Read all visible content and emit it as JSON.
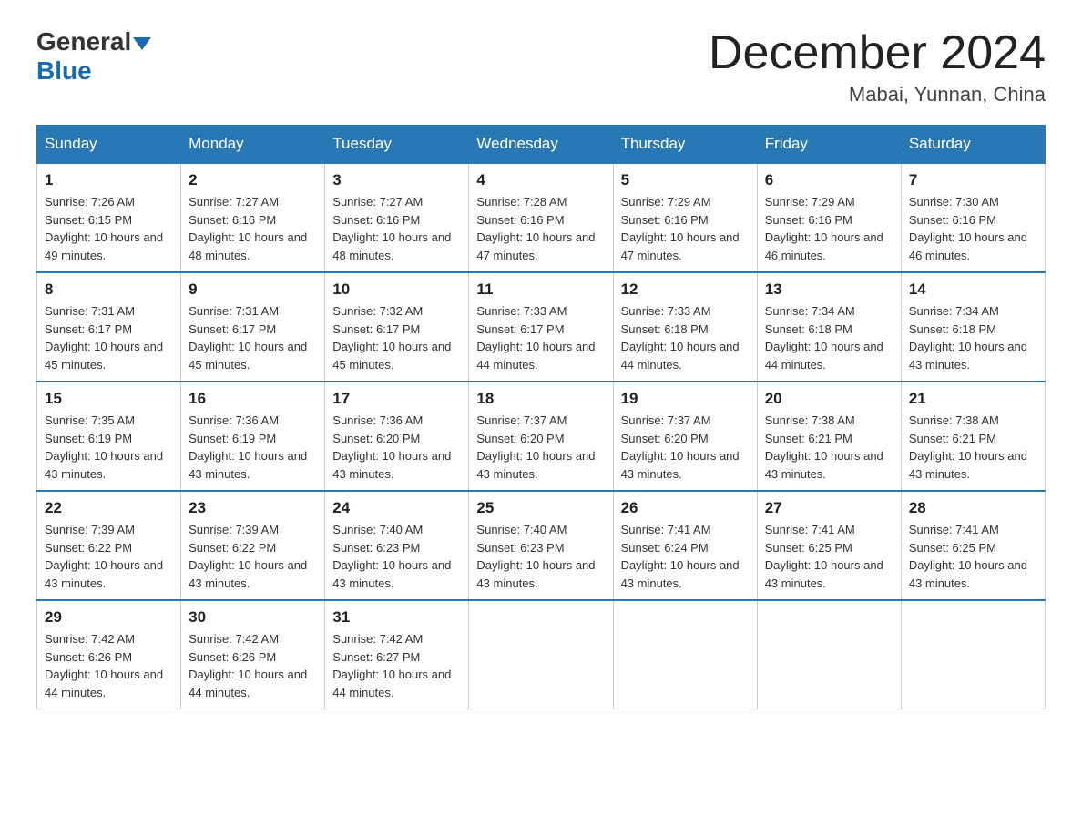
{
  "header": {
    "logo_general": "General",
    "logo_blue": "Blue",
    "month_title": "December 2024",
    "location": "Mabai, Yunnan, China"
  },
  "days_of_week": [
    "Sunday",
    "Monday",
    "Tuesday",
    "Wednesday",
    "Thursday",
    "Friday",
    "Saturday"
  ],
  "weeks": [
    [
      {
        "day": "1",
        "sunrise": "7:26 AM",
        "sunset": "6:15 PM",
        "daylight": "10 hours and 49 minutes."
      },
      {
        "day": "2",
        "sunrise": "7:27 AM",
        "sunset": "6:16 PM",
        "daylight": "10 hours and 48 minutes."
      },
      {
        "day": "3",
        "sunrise": "7:27 AM",
        "sunset": "6:16 PM",
        "daylight": "10 hours and 48 minutes."
      },
      {
        "day": "4",
        "sunrise": "7:28 AM",
        "sunset": "6:16 PM",
        "daylight": "10 hours and 47 minutes."
      },
      {
        "day": "5",
        "sunrise": "7:29 AM",
        "sunset": "6:16 PM",
        "daylight": "10 hours and 47 minutes."
      },
      {
        "day": "6",
        "sunrise": "7:29 AM",
        "sunset": "6:16 PM",
        "daylight": "10 hours and 46 minutes."
      },
      {
        "day": "7",
        "sunrise": "7:30 AM",
        "sunset": "6:16 PM",
        "daylight": "10 hours and 46 minutes."
      }
    ],
    [
      {
        "day": "8",
        "sunrise": "7:31 AM",
        "sunset": "6:17 PM",
        "daylight": "10 hours and 45 minutes."
      },
      {
        "day": "9",
        "sunrise": "7:31 AM",
        "sunset": "6:17 PM",
        "daylight": "10 hours and 45 minutes."
      },
      {
        "day": "10",
        "sunrise": "7:32 AM",
        "sunset": "6:17 PM",
        "daylight": "10 hours and 45 minutes."
      },
      {
        "day": "11",
        "sunrise": "7:33 AM",
        "sunset": "6:17 PM",
        "daylight": "10 hours and 44 minutes."
      },
      {
        "day": "12",
        "sunrise": "7:33 AM",
        "sunset": "6:18 PM",
        "daylight": "10 hours and 44 minutes."
      },
      {
        "day": "13",
        "sunrise": "7:34 AM",
        "sunset": "6:18 PM",
        "daylight": "10 hours and 44 minutes."
      },
      {
        "day": "14",
        "sunrise": "7:34 AM",
        "sunset": "6:18 PM",
        "daylight": "10 hours and 43 minutes."
      }
    ],
    [
      {
        "day": "15",
        "sunrise": "7:35 AM",
        "sunset": "6:19 PM",
        "daylight": "10 hours and 43 minutes."
      },
      {
        "day": "16",
        "sunrise": "7:36 AM",
        "sunset": "6:19 PM",
        "daylight": "10 hours and 43 minutes."
      },
      {
        "day": "17",
        "sunrise": "7:36 AM",
        "sunset": "6:20 PM",
        "daylight": "10 hours and 43 minutes."
      },
      {
        "day": "18",
        "sunrise": "7:37 AM",
        "sunset": "6:20 PM",
        "daylight": "10 hours and 43 minutes."
      },
      {
        "day": "19",
        "sunrise": "7:37 AM",
        "sunset": "6:20 PM",
        "daylight": "10 hours and 43 minutes."
      },
      {
        "day": "20",
        "sunrise": "7:38 AM",
        "sunset": "6:21 PM",
        "daylight": "10 hours and 43 minutes."
      },
      {
        "day": "21",
        "sunrise": "7:38 AM",
        "sunset": "6:21 PM",
        "daylight": "10 hours and 43 minutes."
      }
    ],
    [
      {
        "day": "22",
        "sunrise": "7:39 AM",
        "sunset": "6:22 PM",
        "daylight": "10 hours and 43 minutes."
      },
      {
        "day": "23",
        "sunrise": "7:39 AM",
        "sunset": "6:22 PM",
        "daylight": "10 hours and 43 minutes."
      },
      {
        "day": "24",
        "sunrise": "7:40 AM",
        "sunset": "6:23 PM",
        "daylight": "10 hours and 43 minutes."
      },
      {
        "day": "25",
        "sunrise": "7:40 AM",
        "sunset": "6:23 PM",
        "daylight": "10 hours and 43 minutes."
      },
      {
        "day": "26",
        "sunrise": "7:41 AM",
        "sunset": "6:24 PM",
        "daylight": "10 hours and 43 minutes."
      },
      {
        "day": "27",
        "sunrise": "7:41 AM",
        "sunset": "6:25 PM",
        "daylight": "10 hours and 43 minutes."
      },
      {
        "day": "28",
        "sunrise": "7:41 AM",
        "sunset": "6:25 PM",
        "daylight": "10 hours and 43 minutes."
      }
    ],
    [
      {
        "day": "29",
        "sunrise": "7:42 AM",
        "sunset": "6:26 PM",
        "daylight": "10 hours and 44 minutes."
      },
      {
        "day": "30",
        "sunrise": "7:42 AM",
        "sunset": "6:26 PM",
        "daylight": "10 hours and 44 minutes."
      },
      {
        "day": "31",
        "sunrise": "7:42 AM",
        "sunset": "6:27 PM",
        "daylight": "10 hours and 44 minutes."
      },
      null,
      null,
      null,
      null
    ]
  ]
}
